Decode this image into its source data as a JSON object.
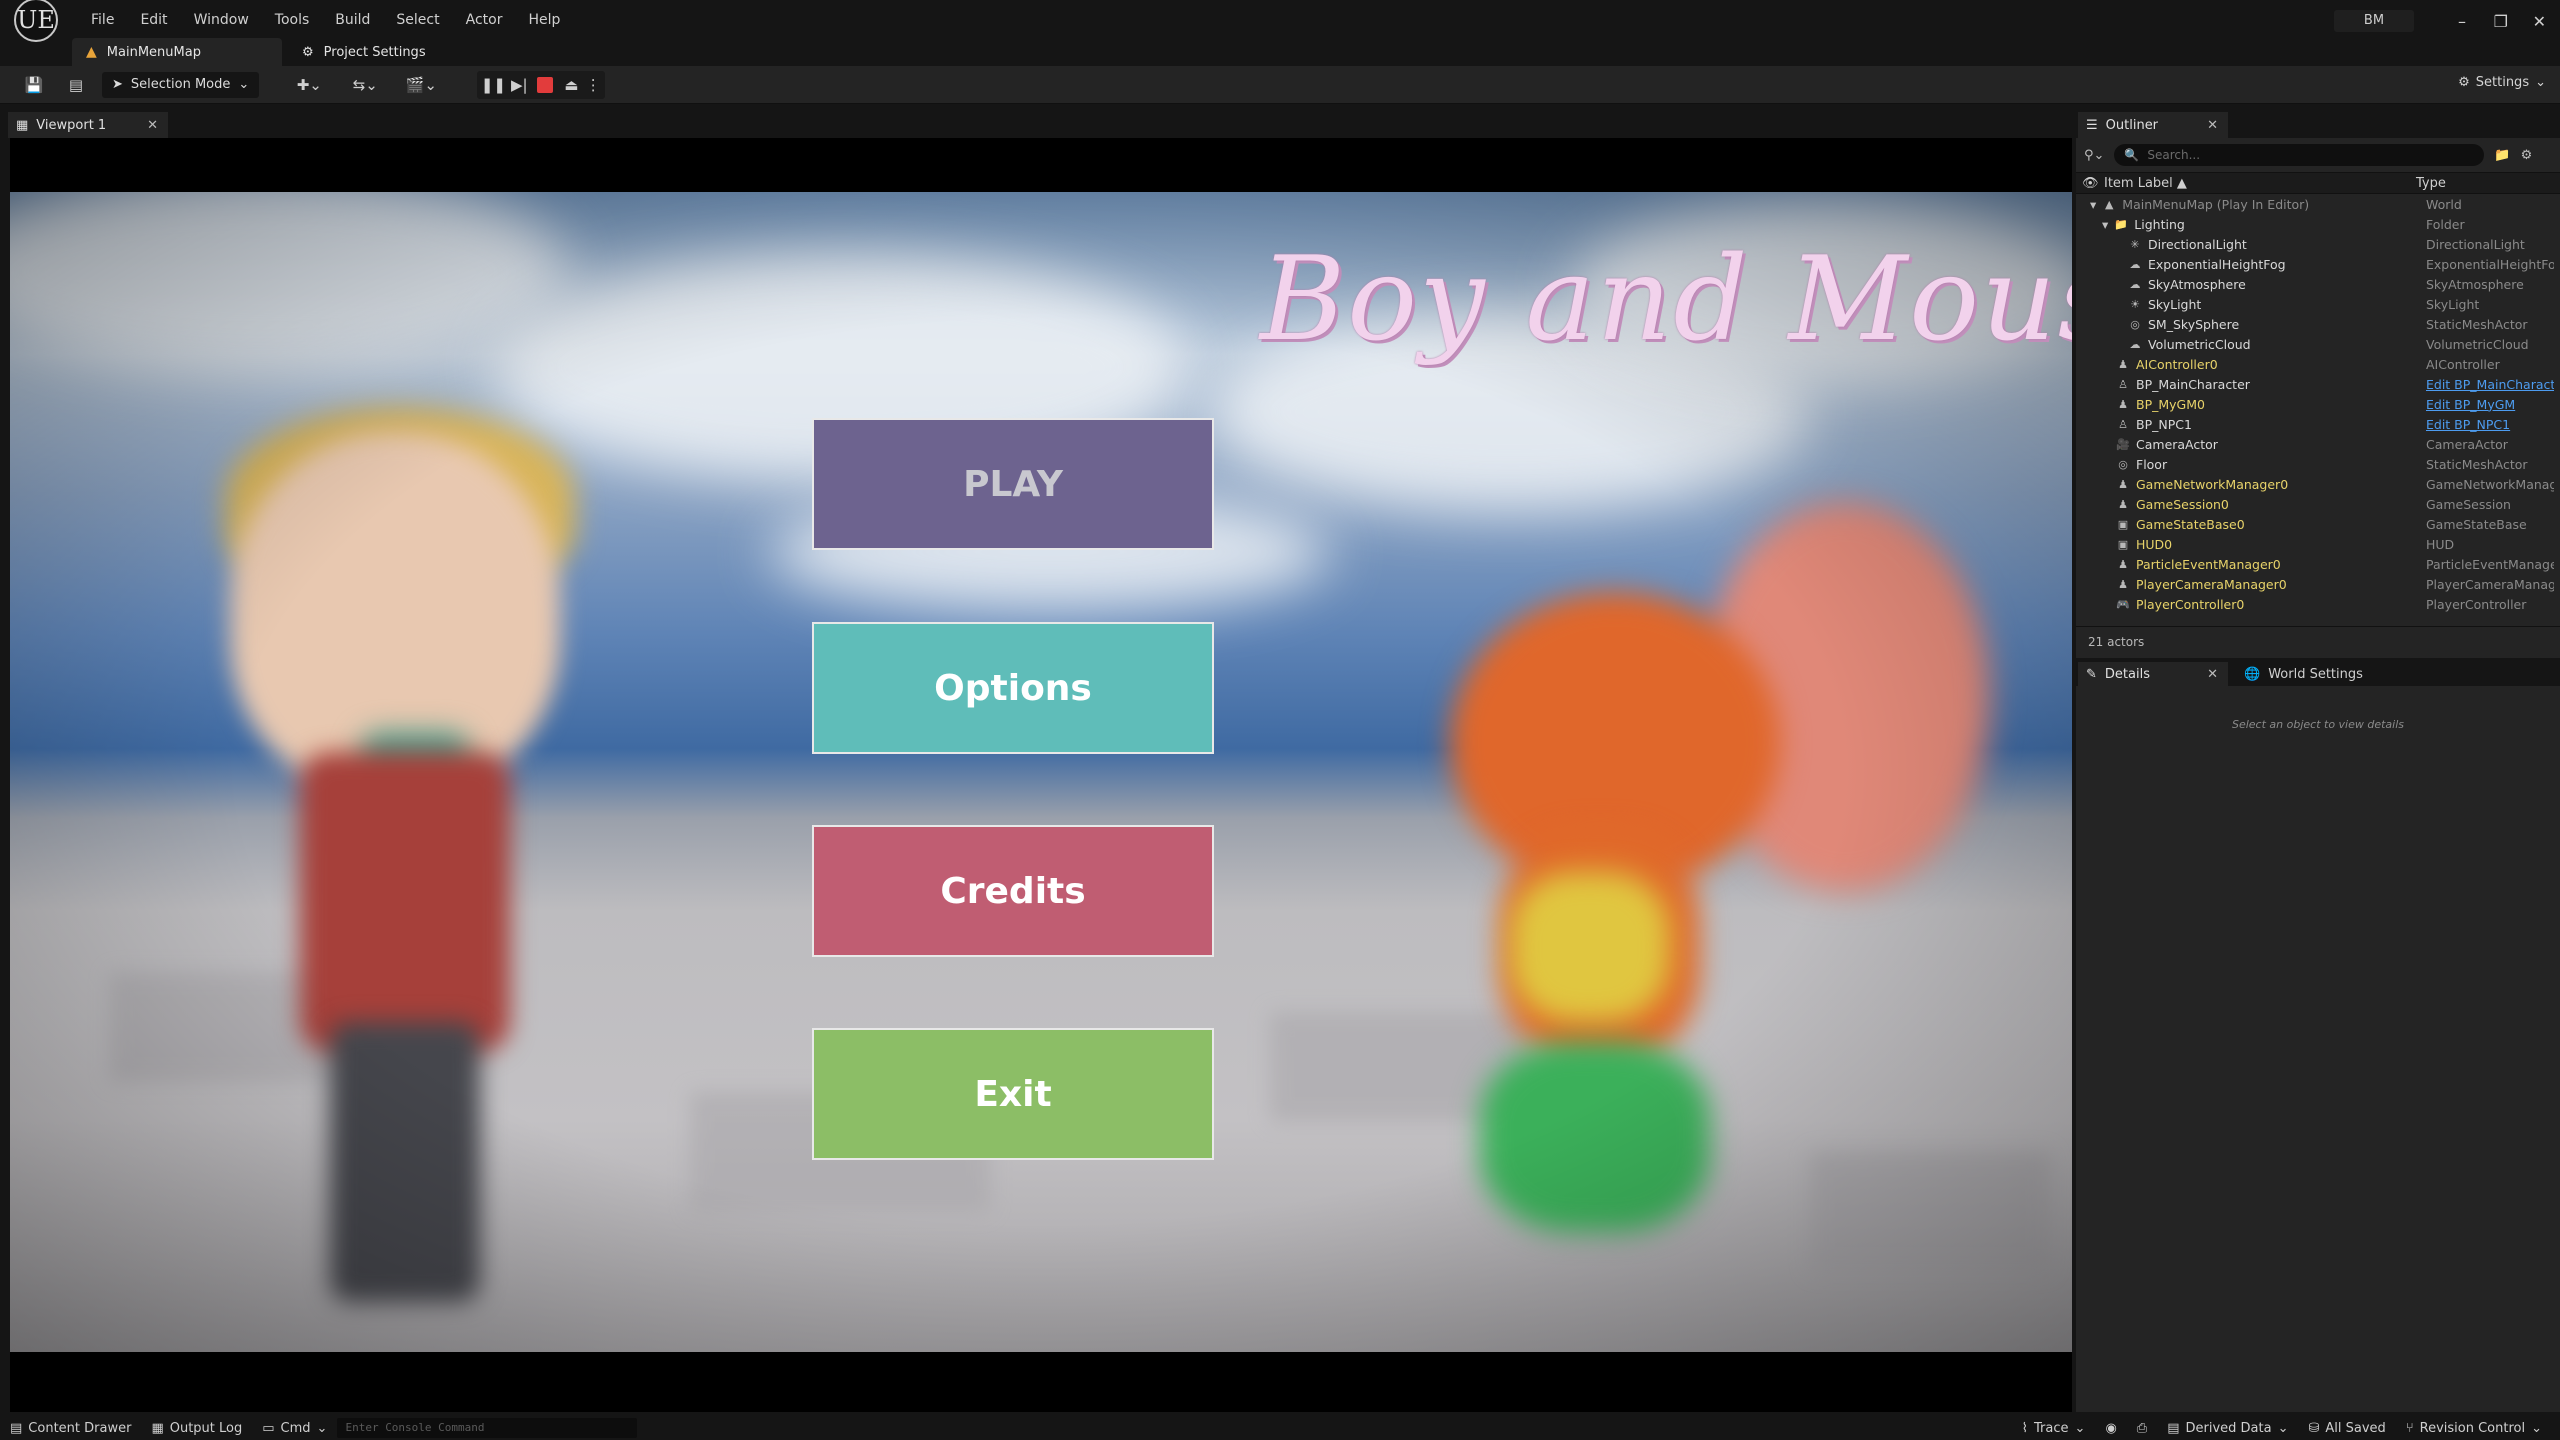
{
  "app": {
    "logo": "UE",
    "user_initials": "BM"
  },
  "menu": [
    "File",
    "Edit",
    "Window",
    "Tools",
    "Build",
    "Select",
    "Actor",
    "Help"
  ],
  "tabs": {
    "level": "MainMenuMap",
    "project_settings": "Project Settings"
  },
  "toolbar": {
    "mode": "Selection Mode",
    "settings": "Settings"
  },
  "viewport": {
    "tab": "Viewport 1",
    "game_title": "Boy and Mouse",
    "buttons": {
      "play": "PLAY",
      "options": "Options",
      "credits": "Credits",
      "exit": "Exit"
    }
  },
  "outliner": {
    "tab": "Outliner",
    "search_placeholder": "Search...",
    "col_label": "Item Label ▲",
    "col_type": "Type",
    "rows": [
      {
        "label": "MainMenuMap (Play In Editor)",
        "type": "World"
      },
      {
        "label": "Lighting",
        "type": "Folder"
      },
      {
        "label": "DirectionalLight",
        "type": "DirectionalLight"
      },
      {
        "label": "ExponentialHeightFog",
        "type": "ExponentialHeightFo"
      },
      {
        "label": "SkyAtmosphere",
        "type": "SkyAtmosphere"
      },
      {
        "label": "SkyLight",
        "type": "SkyLight"
      },
      {
        "label": "SM_SkySphere",
        "type": "StaticMeshActor"
      },
      {
        "label": "VolumetricCloud",
        "type": "VolumetricCloud"
      },
      {
        "label": "AIController0",
        "type": "AIController"
      },
      {
        "label": "BP_MainCharacter",
        "type": "Edit BP_MainCharact"
      },
      {
        "label": "BP_MyGM0",
        "type": "Edit BP_MyGM"
      },
      {
        "label": "BP_NPC1",
        "type": "Edit BP_NPC1"
      },
      {
        "label": "CameraActor",
        "type": "CameraActor"
      },
      {
        "label": "Floor",
        "type": "StaticMeshActor"
      },
      {
        "label": "GameNetworkManager0",
        "type": "GameNetworkManag"
      },
      {
        "label": "GameSession0",
        "type": "GameSession"
      },
      {
        "label": "GameStateBase0",
        "type": "GameStateBase"
      },
      {
        "label": "HUD0",
        "type": "HUD"
      },
      {
        "label": "ParticleEventManager0",
        "type": "ParticleEventManage"
      },
      {
        "label": "PlayerCameraManager0",
        "type": "PlayerCameraManag"
      },
      {
        "label": "PlayerController0",
        "type": "PlayerController"
      }
    ],
    "footer": "21 actors"
  },
  "details": {
    "tab": "Details",
    "world_tab": "World Settings",
    "hint": "Select an object to view details"
  },
  "statusbar": {
    "content_drawer": "Content Drawer",
    "output_log": "Output Log",
    "cmd": "Cmd",
    "console_placeholder": "Enter Console Command",
    "trace": "Trace",
    "derived_data": "Derived Data",
    "all_saved": "All Saved",
    "revision_control": "Revision Control"
  },
  "colors": {
    "play": "#6d638f",
    "options": "#5fbdb9",
    "credits": "#c05d72",
    "exit": "#8cbe66",
    "link": "#4d9cf0",
    "stop": "#e23c3c"
  }
}
